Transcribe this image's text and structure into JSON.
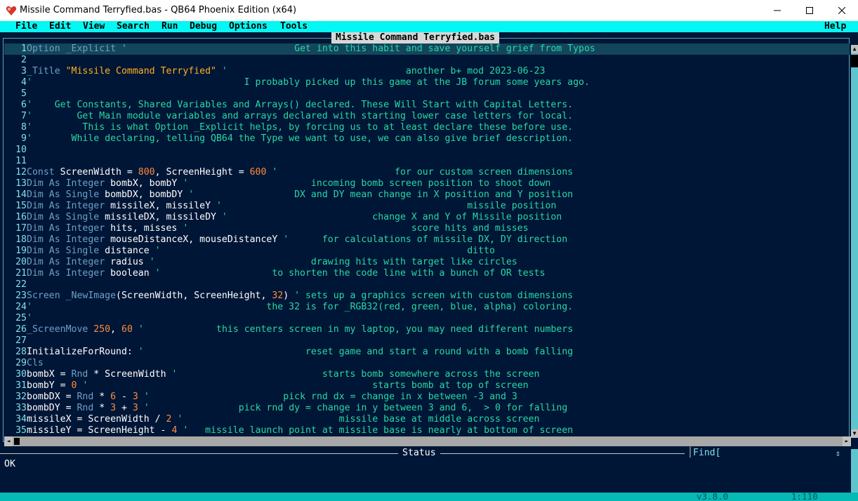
{
  "window": {
    "title": "Missile Command Terryfied.bas - QB64 Phoenix Edition (x64)",
    "icon": "qb64-app-icon",
    "minimize_icon": "minimize-icon",
    "maximize_icon": "maximize-icon",
    "close_icon": "close-icon"
  },
  "menu": {
    "items": [
      "File",
      "Edit",
      "View",
      "Search",
      "Run",
      "Debug",
      "Options",
      "Tools"
    ],
    "help": "Help"
  },
  "editor": {
    "file_title": "Missile Command Terryfied.bas",
    "lines": [
      {
        "n": "1",
        "segs": [
          {
            "t": "Option _Explicit",
            "c": "kw"
          },
          {
            "t": " ",
            "c": "tx"
          },
          {
            "t": "'                              Get into this habit and save yourself grief from Typos",
            "c": "cm"
          }
        ]
      },
      {
        "n": "2",
        "segs": []
      },
      {
        "n": "3",
        "segs": [
          {
            "t": "_Title",
            "c": "kw"
          },
          {
            "t": " ",
            "c": "tx"
          },
          {
            "t": "\"Missile Command Terryfied\"",
            "c": "str"
          },
          {
            "t": " ",
            "c": "tx"
          },
          {
            "t": "'                                another b+ mod 2023-06-23",
            "c": "cm"
          }
        ]
      },
      {
        "n": "4",
        "segs": [
          {
            "t": "'                                      I probably picked up this game at the JB forum some years ago.",
            "c": "cm"
          }
        ]
      },
      {
        "n": "5",
        "segs": []
      },
      {
        "n": "6",
        "segs": [
          {
            "t": "'    Get Constants, Shared Variables and Arrays() declared. These Will Start with Capital Letters.",
            "c": "cm"
          }
        ]
      },
      {
        "n": "7",
        "segs": [
          {
            "t": "'        Get Main module variables and arrays declared with starting lower case letters for local.",
            "c": "cm"
          }
        ]
      },
      {
        "n": "8",
        "segs": [
          {
            "t": "'         This is what Option _Explicit helps, by forcing us to at least declare these before use.",
            "c": "cm"
          }
        ]
      },
      {
        "n": "9",
        "segs": [
          {
            "t": "'       While declaring, telling QB64 the Type we want to use, we can also give brief description.",
            "c": "cm"
          }
        ]
      },
      {
        "n": "10",
        "segs": []
      },
      {
        "n": "11",
        "segs": []
      },
      {
        "n": "12",
        "segs": [
          {
            "t": "Const",
            "c": "kw"
          },
          {
            "t": " ScreenWidth = ",
            "c": "tx"
          },
          {
            "t": "800",
            "c": "num"
          },
          {
            "t": ", ScreenHeight = ",
            "c": "tx"
          },
          {
            "t": "600",
            "c": "num"
          },
          {
            "t": " ",
            "c": "tx"
          },
          {
            "t": "'                     for our custom screen dimensions",
            "c": "cm"
          }
        ]
      },
      {
        "n": "13",
        "segs": [
          {
            "t": "Dim As Integer",
            "c": "kw"
          },
          {
            "t": " bombX, bombY ",
            "c": "tx"
          },
          {
            "t": "'                      incoming bomb screen position to shoot down",
            "c": "cm"
          }
        ]
      },
      {
        "n": "14",
        "segs": [
          {
            "t": "Dim As Single",
            "c": "kw"
          },
          {
            "t": " bombDX, bombDY ",
            "c": "tx"
          },
          {
            "t": "'                  DX and DY mean change in X position and Y position",
            "c": "cm"
          }
        ]
      },
      {
        "n": "15",
        "segs": [
          {
            "t": "Dim As Integer",
            "c": "kw"
          },
          {
            "t": " missileX, missileY ",
            "c": "tx"
          },
          {
            "t": "'                                            missile position",
            "c": "cm"
          }
        ]
      },
      {
        "n": "16",
        "segs": [
          {
            "t": "Dim As Single",
            "c": "kw"
          },
          {
            "t": " missileDX, missileDY ",
            "c": "tx"
          },
          {
            "t": "'                          change X and Y of Missile position",
            "c": "cm"
          }
        ]
      },
      {
        "n": "17",
        "segs": [
          {
            "t": "Dim As Integer",
            "c": "kw"
          },
          {
            "t": " hits, misses ",
            "c": "tx"
          },
          {
            "t": "'                                        score hits and misses",
            "c": "cm"
          }
        ]
      },
      {
        "n": "18",
        "segs": [
          {
            "t": "Dim As Integer",
            "c": "kw"
          },
          {
            "t": " mouseDistanceX, mouseDistanceY ",
            "c": "tx"
          },
          {
            "t": "'      for calculations of missile DX, DY direction",
            "c": "cm"
          }
        ]
      },
      {
        "n": "19",
        "segs": [
          {
            "t": "Dim As Single",
            "c": "kw"
          },
          {
            "t": " distance ",
            "c": "tx"
          },
          {
            "t": "'                                                       ditto",
            "c": "cm"
          }
        ]
      },
      {
        "n": "20",
        "segs": [
          {
            "t": "Dim As Integer",
            "c": "kw"
          },
          {
            "t": " radius ",
            "c": "tx"
          },
          {
            "t": "'                            drawing hits with target like circles",
            "c": "cm"
          }
        ]
      },
      {
        "n": "21",
        "segs": [
          {
            "t": "Dim As Integer",
            "c": "kw"
          },
          {
            "t": " boolean ",
            "c": "tx"
          },
          {
            "t": "'                    to shorten the code line with a bunch of OR tests",
            "c": "cm"
          }
        ]
      },
      {
        "n": "22",
        "segs": []
      },
      {
        "n": "23",
        "segs": [
          {
            "t": "Screen _NewImage",
            "c": "kw"
          },
          {
            "t": "(ScreenWidth, ScreenHeight, ",
            "c": "tx"
          },
          {
            "t": "32",
            "c": "num"
          },
          {
            "t": ") ",
            "c": "tx"
          },
          {
            "t": "' sets up a graphics screen with custom dimensions",
            "c": "cm"
          }
        ]
      },
      {
        "n": "24",
        "segs": [
          {
            "t": "'                                          the 32 is for _RGB32(red, green, blue, alpha) coloring.",
            "c": "cm"
          }
        ]
      },
      {
        "n": "25",
        "segs": [
          {
            "t": "'",
            "c": "cm"
          }
        ]
      },
      {
        "n": "26",
        "segs": [
          {
            "t": "_ScreenMove",
            "c": "kw"
          },
          {
            "t": " ",
            "c": "tx"
          },
          {
            "t": "250",
            "c": "num"
          },
          {
            "t": ", ",
            "c": "tx"
          },
          {
            "t": "60",
            "c": "num"
          },
          {
            "t": " ",
            "c": "tx"
          },
          {
            "t": "'             this centers screen in my laptop, you may need different numbers",
            "c": "cm"
          }
        ]
      },
      {
        "n": "27",
        "segs": []
      },
      {
        "n": "28",
        "segs": [
          {
            "t": "InitializeForRound: ",
            "c": "tx"
          },
          {
            "t": "'                             reset game and start a round with a bomb falling",
            "c": "cm"
          }
        ]
      },
      {
        "n": "29",
        "segs": [
          {
            "t": "Cls",
            "c": "kw"
          }
        ]
      },
      {
        "n": "30",
        "segs": [
          {
            "t": "bombX = ",
            "c": "tx"
          },
          {
            "t": "Rnd",
            "c": "kw"
          },
          {
            "t": " * ScreenWidth ",
            "c": "tx"
          },
          {
            "t": "'                          starts bomb somewhere across the screen",
            "c": "cm"
          }
        ]
      },
      {
        "n": "31",
        "segs": [
          {
            "t": "bombY = ",
            "c": "tx"
          },
          {
            "t": "0",
            "c": "num"
          },
          {
            "t": " ",
            "c": "tx"
          },
          {
            "t": "'                                                   starts bomb at top of screen",
            "c": "cm"
          }
        ]
      },
      {
        "n": "32",
        "segs": [
          {
            "t": "bombDX = ",
            "c": "tx"
          },
          {
            "t": "Rnd",
            "c": "kw"
          },
          {
            "t": " * ",
            "c": "tx"
          },
          {
            "t": "6",
            "c": "num"
          },
          {
            "t": " - ",
            "c": "tx"
          },
          {
            "t": "3",
            "c": "num"
          },
          {
            "t": " ",
            "c": "tx"
          },
          {
            "t": "'                        pick rnd dx = change in x between -3 and 3",
            "c": "cm"
          }
        ]
      },
      {
        "n": "33",
        "segs": [
          {
            "t": "bombDY = ",
            "c": "tx"
          },
          {
            "t": "Rnd",
            "c": "kw"
          },
          {
            "t": " * ",
            "c": "tx"
          },
          {
            "t": "3",
            "c": "num"
          },
          {
            "t": " + ",
            "c": "tx"
          },
          {
            "t": "3",
            "c": "num"
          },
          {
            "t": " ",
            "c": "tx"
          },
          {
            "t": "'                pick rnd dy = change in y between 3 and 6,  > 0 for falling",
            "c": "cm"
          }
        ]
      },
      {
        "n": "34",
        "segs": [
          {
            "t": "missileX = ScreenWidth / ",
            "c": "tx"
          },
          {
            "t": "2",
            "c": "num"
          },
          {
            "t": " ",
            "c": "tx"
          },
          {
            "t": "'                            missile base at middle across screen",
            "c": "cm"
          }
        ]
      },
      {
        "n": "35",
        "segs": [
          {
            "t": "missileY = ScreenHeight - ",
            "c": "tx"
          },
          {
            "t": "4",
            "c": "num"
          },
          {
            "t": " ",
            "c": "tx"
          },
          {
            "t": "'   missile launch point at missile base is nearly at bottom of screen",
            "c": "cm"
          }
        ]
      }
    ]
  },
  "status": {
    "label": "Status",
    "message": "OK",
    "find_label": "Find[",
    "find_arrows": "⇕"
  },
  "bottombar": {
    "version": "v3.8.0",
    "position": "1:110"
  },
  "colors": {
    "menu_bg": "#05f7f4",
    "editor_bg": "#001636",
    "keyword": "#6ea0c8",
    "string": "#ffb020",
    "number": "#ff8a40",
    "comment": "#28d8a4"
  }
}
